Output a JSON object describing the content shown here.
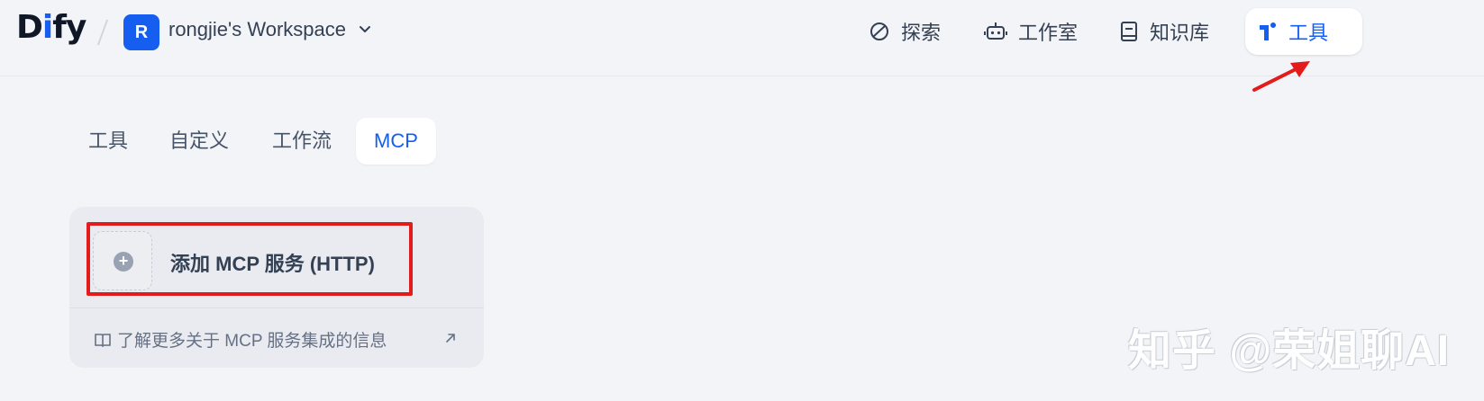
{
  "app": {
    "logo": "Dify"
  },
  "workspace": {
    "avatar_letter": "R",
    "name": "rongjie's Workspace"
  },
  "nav": [
    {
      "label": "探索",
      "icon": "compass-icon"
    },
    {
      "label": "工作室",
      "icon": "robot-icon"
    },
    {
      "label": "知识库",
      "icon": "book-icon"
    },
    {
      "label": "工具",
      "icon": "tool-icon",
      "active": true
    }
  ],
  "tabs": [
    {
      "label": "工具"
    },
    {
      "label": "自定义"
    },
    {
      "label": "工作流"
    },
    {
      "label": "MCP",
      "active": true
    }
  ],
  "card": {
    "add_label": "添加 MCP 服务 (HTTP)",
    "learn_more": "了解更多关于 MCP 服务集成的信息"
  },
  "watermark": "知乎 @荣姐聊AI",
  "colors": {
    "accent": "#155eef",
    "annotation": "#e31b1b",
    "background": "#f2f4f7"
  }
}
